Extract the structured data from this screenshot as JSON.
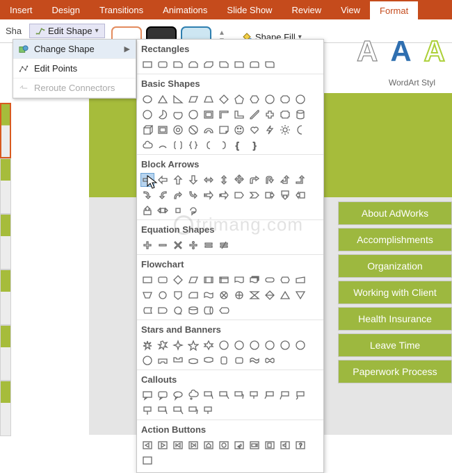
{
  "tabs": [
    "Insert",
    "Design",
    "Transitions",
    "Animations",
    "Slide Show",
    "Review",
    "View",
    "Format"
  ],
  "active_tab_index": 7,
  "ribbon": {
    "sh_label": "Sha",
    "edit_shape": "Edit Shape",
    "shape_fill": "Shape Fill"
  },
  "dropdown": {
    "change_shape": "Change Shape",
    "edit_points": "Edit Points",
    "reroute": "Reroute Connectors"
  },
  "wordart": {
    "letters": [
      "A",
      "A",
      "A"
    ],
    "caption": "WordArt Styl"
  },
  "right_buttons": [
    "About AdWorks",
    "Accomplishments",
    "Organization",
    "Working with Client",
    "Health Insurance",
    "Leave Time",
    "Paperwork Process"
  ],
  "shape_categories": [
    "Rectangles",
    "Basic Shapes",
    "Block Arrows",
    "Equation Shapes",
    "Flowchart",
    "Stars and Banners",
    "Callouts",
    "Action Buttons"
  ],
  "watermark": "trimang.com"
}
